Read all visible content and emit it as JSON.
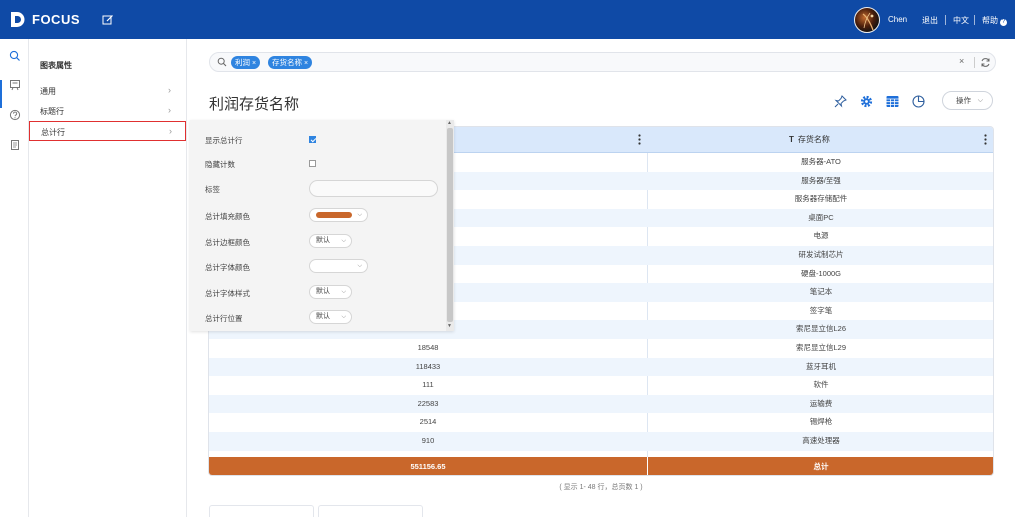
{
  "app": {
    "name": "FOCUS"
  },
  "topbar": {
    "user_name": "Chen",
    "logout_label": "退出",
    "language_label": "中文",
    "help_label": "帮助",
    "help_glyph": "?"
  },
  "side_panel": {
    "title": "图表属性",
    "items": [
      {
        "label": "通用",
        "chevron": "›"
      },
      {
        "label": "标题行",
        "chevron": "›"
      },
      {
        "label": "总计行",
        "chevron": "›",
        "active": true
      }
    ]
  },
  "search": {
    "chips": [
      {
        "label": "利润",
        "remove": "×"
      },
      {
        "label": "存货名称",
        "remove": "×"
      }
    ],
    "clear_glyph": "×"
  },
  "page_title": "利润存货名称",
  "toolbar": {
    "operate_label": "操作",
    "operate_caret": "⌵"
  },
  "table": {
    "columns": [
      {
        "label": ""
      },
      {
        "label": "存货名称",
        "type_glyph": "T"
      }
    ],
    "rows": [
      {
        "profit": "",
        "name": "服务器-ATO"
      },
      {
        "profit": "",
        "name": "服务器/至强"
      },
      {
        "profit": "",
        "name": "服务器存储配件"
      },
      {
        "profit": "",
        "name": "桌面PC"
      },
      {
        "profit": "",
        "name": "电源"
      },
      {
        "profit": "",
        "name": "研发试制芯片"
      },
      {
        "profit": "",
        "name": "硬盘-1000G"
      },
      {
        "profit": "",
        "name": "笔记本"
      },
      {
        "profit": "",
        "name": "签字笔"
      },
      {
        "profit": "5014",
        "name": "索尼显立信L26"
      },
      {
        "profit": "18548",
        "name": "索尼显立信L29"
      },
      {
        "profit": "118433",
        "name": "蓝牙耳机"
      },
      {
        "profit": "111",
        "name": "软件"
      },
      {
        "profit": "22583",
        "name": "运输费"
      },
      {
        "profit": "2514",
        "name": "锡焊枪"
      },
      {
        "profit": "910",
        "name": "高速处理器"
      }
    ],
    "total": {
      "value": "551156.65",
      "label": "总计"
    },
    "footer": "( 显示 1- 48 行，总页数 1 )"
  },
  "popover": {
    "rows": [
      {
        "label": "显示总计行",
        "control": "checkbox",
        "checked": true
      },
      {
        "label": "隐藏计数",
        "control": "checkbox",
        "checked": false
      },
      {
        "label": "标签",
        "control": "text",
        "value": ""
      },
      {
        "label": "总计填充颜色",
        "control": "color",
        "color": "#c9672b"
      },
      {
        "label": "总计边框颜色",
        "control": "select",
        "value": "默认"
      },
      {
        "label": "总计字体颜色",
        "control": "select",
        "value": ""
      },
      {
        "label": "总计字体样式",
        "control": "select",
        "value": "默认"
      },
      {
        "label": "总计行位置",
        "control": "select",
        "value": "默认"
      }
    ],
    "select_caret": "⌵",
    "scroll_up": "▲",
    "scroll_down": "▼"
  },
  "colors": {
    "topbar": "#0f4aa6",
    "accent": "#2f84e0",
    "total_row": "#c9672b",
    "header_row": "#d9e8fb",
    "active_outline": "#e03030"
  },
  "icons": {
    "search": "search-icon",
    "rail": [
      "search-icon",
      "board-icon",
      "help-circle-icon",
      "document-icon"
    ],
    "toolbar": [
      "pin-icon",
      "gear-icon",
      "table-view-icon",
      "pie-chart-icon"
    ]
  }
}
